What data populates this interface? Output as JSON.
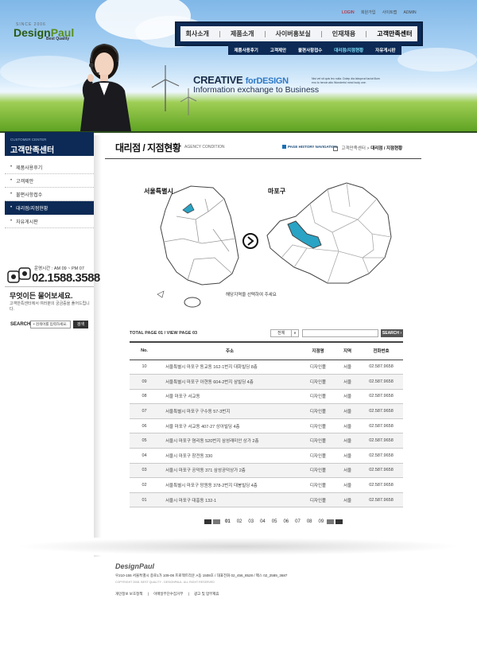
{
  "header": {
    "since": "SINCE 2006",
    "logo_main": "Design",
    "logo_accent": "Paul",
    "logo_sub": "Best Quality",
    "top_links": [
      "LOGIN",
      "회원가입",
      "사이트맵",
      "ADMIN"
    ],
    "gnb": [
      "회사소개",
      "제품소개",
      "사이버홍보실",
      "인재채용",
      "고객만족센터"
    ],
    "subnav": [
      "제품사용후기",
      "고객제안",
      "불편사항접수",
      "대리점/지점현황",
      "자유게시판"
    ],
    "slogan_prefix": "CREATIVE ",
    "slogan_accent": "forDESIGN",
    "slogan_line2": "Information exchange to Business",
    "slogan_small": "Nisi vel sit quis leo nulla. Dolep dia laboprod laciut illum enu to heroin alto Wonderful mind body one."
  },
  "sidebar": {
    "sub": "CUSTOMER CENTER",
    "title": "고객만족센터",
    "items": [
      {
        "label": "제품사용후기",
        "active": false
      },
      {
        "label": "고객제안",
        "active": false
      },
      {
        "label": "불편사항접수",
        "active": false
      },
      {
        "label": "대리점/지점현황",
        "active": true
      },
      {
        "label": "자유게시판",
        "active": false
      }
    ],
    "hours": "운영시간 : AM 09 ~ PM 07",
    "phone": "02.1588.3588",
    "cs_title": "무엇이든 물어보세요.",
    "cs_desc": "고객만족센터에서 여러분의 궁금증을 풀어드립니다.",
    "search_label": "SEARCH",
    "search_placeholder": "• 검색어를 입력하세요.",
    "search_button": "검색"
  },
  "content": {
    "title": "대리점 / 지점현황",
    "title_en": "AGENCY CONDITION",
    "history": "PAGE HISTORY NAVIGATION",
    "crumb_1": "고객만족센터",
    "crumb_sep": " > ",
    "crumb_2": "대리점 / 지점현황",
    "map_label_left": "서울특별시",
    "map_label_right": "마포구",
    "map_hint": "해당지역을 선택하여 주세요",
    "total_page": "TOTAL PAGE 01   /  VIEW PAGE  03",
    "select_value": "전체",
    "select_arrow": "∨",
    "search_button": "SEARCH ›",
    "columns": [
      "No.",
      "주소",
      "지점명",
      "지역",
      "전화번호"
    ],
    "rows": [
      [
        "10",
        "서울특별시 마포구 동교동 162-1번지 대화빌딩 8층",
        "디자인폴",
        "서울",
        "02.587.9658"
      ],
      [
        "09",
        "서울특별시 마포구 아현동 604-2번지 삼빌딩 4층",
        "디자인폴",
        "서울",
        "02.587.9658"
      ],
      [
        "08",
        "서울 마포구 서교동",
        "디자인폴",
        "서울",
        "02.587.9658"
      ],
      [
        "07",
        "서울특별시 마포구 구수동 57-3번지",
        "디자인폴",
        "서울",
        "02.587.9658"
      ],
      [
        "06",
        "서울 마포구 서교동 407-27 상아빌딩 4층",
        "디자인폴",
        "서울",
        "02.587.9658"
      ],
      [
        "05",
        "서울시 마포구 염리동 520번지 삼성래미안 상가 2층",
        "디자인폴",
        "서울",
        "02.587.9658"
      ],
      [
        "04",
        "서울시 마포구 창전동 330",
        "디자인폴",
        "서울",
        "02.587.9658"
      ],
      [
        "03",
        "서울시 마포구 공덕동 371 삼성공덕상가 2층",
        "디자인폴",
        "서울",
        "02.587.9658"
      ],
      [
        "02",
        "서울특별시 마포구 망원동 378-2번지 대봉빌딩 4층",
        "디자인폴",
        "서울",
        "02.587.9658"
      ],
      [
        "01",
        "서울시 마포구 대흥동 132-1",
        "디자인폴",
        "서울",
        "02.587.9658"
      ]
    ],
    "pages": [
      "01",
      "02",
      "03",
      "04",
      "05",
      "06",
      "07",
      "08",
      "09"
    ]
  },
  "footer": {
    "logo": "DesignPaul",
    "address": "우210-155 서울특별시 종로1가 109-08 프로젝트라운 A동 1508호  /  대표전화 02_456_8528  /  팩스 02_2589_3687",
    "copyright": "COPYRIGHT 2008. BEST QUALITY - DESIGNPAUL. ALL RIGHT RESERVED",
    "links": [
      "개인정보 보호정책",
      "|",
      "이메일무단수집거부",
      "|",
      "광고 및 업무제휴"
    ]
  },
  "colors": {
    "navy": "#0c2a55",
    "highlight": "#2aa3c4",
    "grass": "#5fa323"
  }
}
